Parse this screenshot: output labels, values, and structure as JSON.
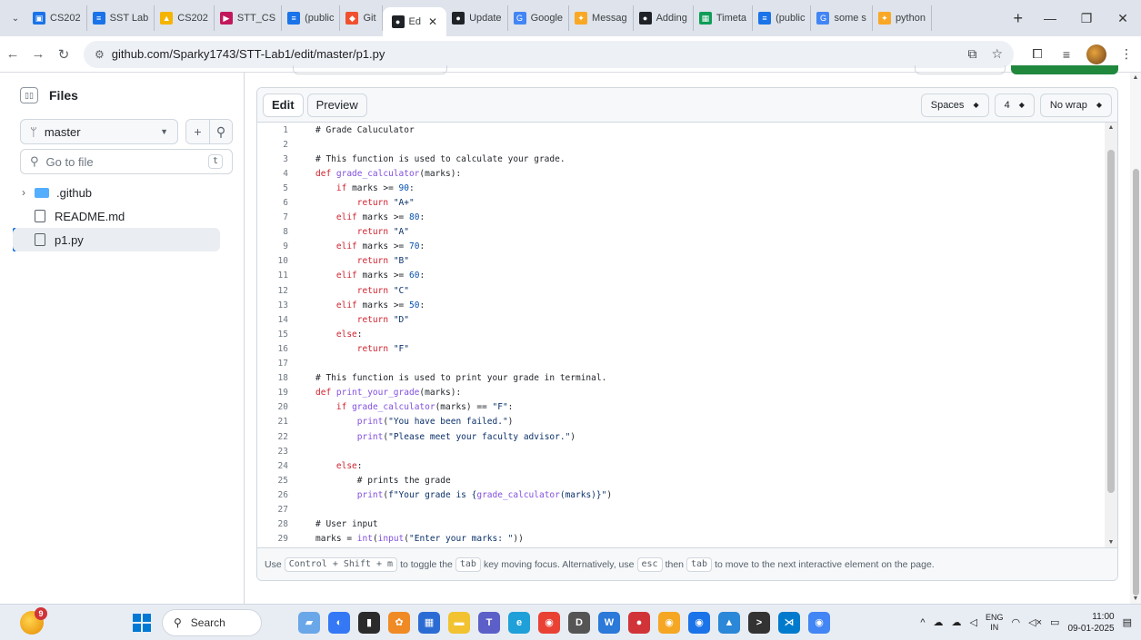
{
  "browser": {
    "tabs": [
      {
        "label": "CS202",
        "color": "#1a73e8",
        "glyph": "▣"
      },
      {
        "label": "SST Lab",
        "color": "#1a73e8",
        "glyph": "≡"
      },
      {
        "label": "CS202",
        "color": "#f4b400",
        "glyph": "▲"
      },
      {
        "label": "STT_CS",
        "color": "#c2185b",
        "glyph": "▶"
      },
      {
        "label": "(public",
        "color": "#1a73e8",
        "glyph": "≡"
      },
      {
        "label": "Git",
        "color": "#f1502f",
        "glyph": "◆"
      },
      {
        "label": "Ed",
        "color": "#1f2328",
        "glyph": "●",
        "active": true
      },
      {
        "label": "Update",
        "color": "#1f2328",
        "glyph": "●"
      },
      {
        "label": "Google",
        "color": "#4285f4",
        "glyph": "G"
      },
      {
        "label": "Messag",
        "color": "#f9a825",
        "glyph": "✦"
      },
      {
        "label": "Adding",
        "color": "#1f2328",
        "glyph": "●"
      },
      {
        "label": "Timeta",
        "color": "#0f9d58",
        "glyph": "▦"
      },
      {
        "label": "(public",
        "color": "#1a73e8",
        "glyph": "≡"
      },
      {
        "label": "some s",
        "color": "#4285f4",
        "glyph": "G"
      },
      {
        "label": "python",
        "color": "#f9a825",
        "glyph": "✦"
      }
    ],
    "url": "github.com/Sparky1743/STT-Lab1/edit/master/p1.py"
  },
  "sidebar": {
    "title": "Files",
    "branch": "master",
    "goto_placeholder": "Go to file",
    "goto_shortcut": "t",
    "tree": [
      {
        "label": ".github",
        "type": "folder"
      },
      {
        "label": "README.md",
        "type": "file"
      },
      {
        "label": "p1.py",
        "type": "file",
        "selected": true
      }
    ]
  },
  "editor": {
    "tab_edit": "Edit",
    "tab_preview": "Preview",
    "indent_mode": "Spaces",
    "indent_size": "4",
    "wrap_mode": "No wrap",
    "lines": [
      [
        [
          "cm",
          "# Grade Caluculator"
        ]
      ],
      [],
      [
        [
          "cm",
          "# This function is used to calculate your grade."
        ]
      ],
      [
        [
          "kw",
          "def "
        ],
        [
          "fn",
          "grade_calculator"
        ],
        [
          "cm",
          "(marks):"
        ]
      ],
      [
        [
          "cm",
          "    "
        ],
        [
          "kw",
          "if"
        ],
        [
          "cm",
          " marks >= "
        ],
        [
          "num",
          "90"
        ],
        [
          "cm",
          ":"
        ]
      ],
      [
        [
          "cm",
          "        "
        ],
        [
          "kw",
          "return "
        ],
        [
          "st",
          "\"A+\""
        ]
      ],
      [
        [
          "cm",
          "    "
        ],
        [
          "kw",
          "elif"
        ],
        [
          "cm",
          " marks >= "
        ],
        [
          "num",
          "80"
        ],
        [
          "cm",
          ":"
        ]
      ],
      [
        [
          "cm",
          "        "
        ],
        [
          "kw",
          "return "
        ],
        [
          "st",
          "\"A\""
        ]
      ],
      [
        [
          "cm",
          "    "
        ],
        [
          "kw",
          "elif"
        ],
        [
          "cm",
          " marks >= "
        ],
        [
          "num",
          "70"
        ],
        [
          "cm",
          ":"
        ]
      ],
      [
        [
          "cm",
          "        "
        ],
        [
          "kw",
          "return "
        ],
        [
          "st",
          "\"B\""
        ]
      ],
      [
        [
          "cm",
          "    "
        ],
        [
          "kw",
          "elif"
        ],
        [
          "cm",
          " marks >= "
        ],
        [
          "num",
          "60"
        ],
        [
          "cm",
          ":"
        ]
      ],
      [
        [
          "cm",
          "        "
        ],
        [
          "kw",
          "return "
        ],
        [
          "st",
          "\"C\""
        ]
      ],
      [
        [
          "cm",
          "    "
        ],
        [
          "kw",
          "elif"
        ],
        [
          "cm",
          " marks >= "
        ],
        [
          "num",
          "50"
        ],
        [
          "cm",
          ":"
        ]
      ],
      [
        [
          "cm",
          "        "
        ],
        [
          "kw",
          "return "
        ],
        [
          "st",
          "\"D\""
        ]
      ],
      [
        [
          "cm",
          "    "
        ],
        [
          "kw",
          "else"
        ],
        [
          "cm",
          ":"
        ]
      ],
      [
        [
          "cm",
          "        "
        ],
        [
          "kw",
          "return "
        ],
        [
          "st",
          "\"F\""
        ]
      ],
      [],
      [
        [
          "cm",
          "# This function is used to print your grade in terminal."
        ]
      ],
      [
        [
          "kw",
          "def "
        ],
        [
          "fn",
          "print_your_grade"
        ],
        [
          "cm",
          "(marks):"
        ]
      ],
      [
        [
          "cm",
          "    "
        ],
        [
          "kw",
          "if "
        ],
        [
          "fn",
          "grade_calculator"
        ],
        [
          "cm",
          "(marks) == "
        ],
        [
          "st",
          "\"F\""
        ],
        [
          "cm",
          ":"
        ]
      ],
      [
        [
          "cm",
          "        "
        ],
        [
          "fn",
          "print"
        ],
        [
          "cm",
          "("
        ],
        [
          "st",
          "\"You have been failed.\""
        ],
        [
          "cm",
          ")"
        ]
      ],
      [
        [
          "cm",
          "        "
        ],
        [
          "fn",
          "print"
        ],
        [
          "cm",
          "("
        ],
        [
          "st",
          "\"Please meet your faculty advisor.\""
        ],
        [
          "cm",
          ")"
        ]
      ],
      [],
      [
        [
          "cm",
          "    "
        ],
        [
          "kw",
          "else"
        ],
        [
          "cm",
          ":"
        ]
      ],
      [
        [
          "cm",
          "        # prints the grade"
        ]
      ],
      [
        [
          "cm",
          "        "
        ],
        [
          "fn",
          "print"
        ],
        [
          "cm",
          "("
        ],
        [
          "st",
          "f\"Your grade is {"
        ],
        [
          "fn",
          "grade_calculator"
        ],
        [
          "st",
          "(marks)}\""
        ],
        [
          "cm",
          ")"
        ]
      ],
      [],
      [
        [
          "cm",
          "# User input"
        ]
      ],
      [
        [
          "cm",
          "marks = "
        ],
        [
          "fn",
          "int"
        ],
        [
          "cm",
          "("
        ],
        [
          "fn",
          "input"
        ],
        [
          "cm",
          "("
        ],
        [
          "st",
          "\"Enter your marks: \""
        ],
        [
          "cm",
          "))"
        ]
      ]
    ],
    "footer": {
      "use": "Use",
      "kbd_toggle": "Control + Shift + m",
      "to_toggle": "to toggle the",
      "kbd_tab": "tab",
      "key_moving": "key moving focus. Alternatively, use",
      "kbd_esc": "esc",
      "then": "then",
      "kbd_tab2": "tab",
      "rest": "to move to the next interactive element on the page."
    }
  },
  "taskbar": {
    "notification_count": "9",
    "search_label": "Search",
    "apps": [
      {
        "name": "photos",
        "color": "#6aa7e8",
        "glyph": "▰"
      },
      {
        "name": "copilot",
        "color": "#3478f6",
        "glyph": "◐"
      },
      {
        "name": "terminal",
        "color": "#2b2b2b",
        "glyph": "▮"
      },
      {
        "name": "paint",
        "color": "#f08a24",
        "glyph": "✿"
      },
      {
        "name": "store",
        "color": "#2b6cd4",
        "glyph": "▦"
      },
      {
        "name": "explorer",
        "color": "#f2c230",
        "glyph": "▬"
      },
      {
        "name": "teams",
        "color": "#5b5fc7",
        "glyph": "T"
      },
      {
        "name": "edge",
        "color": "#1fa0d8",
        "glyph": "e"
      },
      {
        "name": "chrome",
        "color": "#e94235",
        "glyph": "◉"
      },
      {
        "name": "dell",
        "color": "#555",
        "glyph": "D"
      },
      {
        "name": "word",
        "color": "#2b79d8",
        "glyph": "W"
      },
      {
        "name": "record",
        "color": "#d13438",
        "glyph": "●"
      },
      {
        "name": "chrome-canary",
        "color": "#f5a623",
        "glyph": "◉"
      },
      {
        "name": "chrome-dev",
        "color": "#1a73e8",
        "glyph": "◉"
      },
      {
        "name": "photos2",
        "color": "#2b87d8",
        "glyph": "▲"
      },
      {
        "name": "terminal2",
        "color": "#333",
        "glyph": ">"
      },
      {
        "name": "vscode",
        "color": "#007acc",
        "glyph": "⋊"
      },
      {
        "name": "chrome2",
        "color": "#4285f4",
        "glyph": "◉"
      }
    ],
    "lang_top": "ENG",
    "lang_bottom": "IN",
    "time": "11:00",
    "date": "09-01-2025"
  }
}
